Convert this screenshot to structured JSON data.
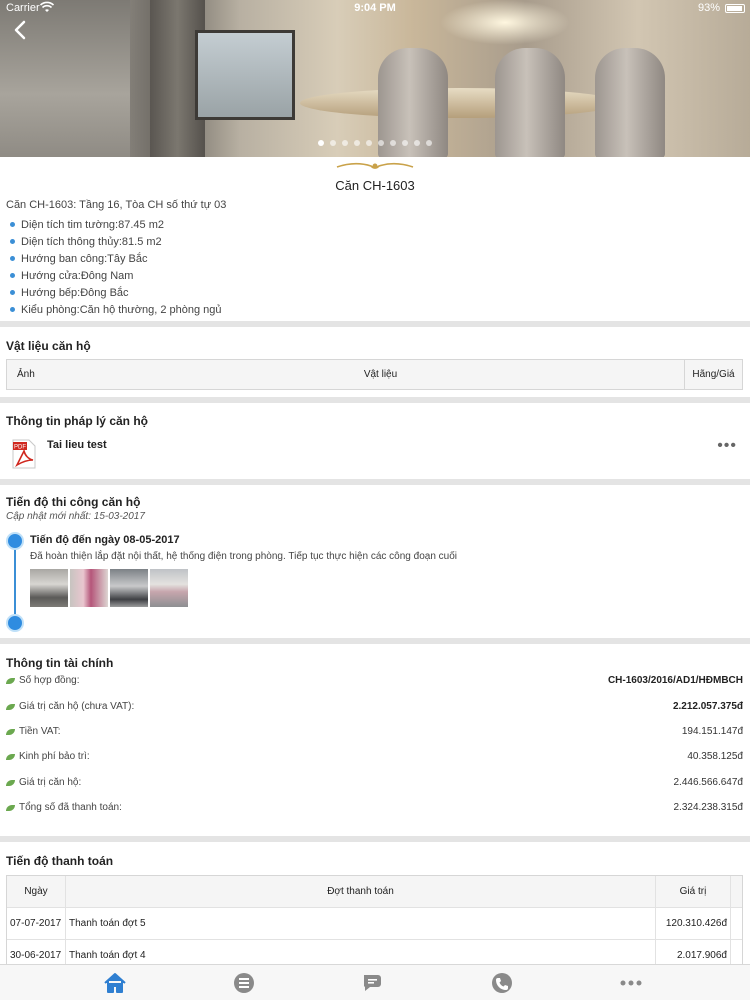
{
  "status_bar": {
    "carrier": "Carrier",
    "time": "9:04 PM",
    "battery": "93%"
  },
  "gallery": {
    "dot_count": 10,
    "active_index": 0
  },
  "apartment": {
    "title": "Căn CH-1603",
    "description": "Căn CH-1603: Tầng 16, Tòa CH số thứ tự 03",
    "specs": [
      "Diện tích tim tường:87.45 m2",
      "Diện tích thông thủy:81.5 m2",
      "Hướng ban công:Tây Bắc",
      "Hướng cửa:Đông Nam",
      "Hướng bếp:Đông Bắc",
      "Kiểu phòng:Căn hộ thường, 2 phòng ngủ"
    ]
  },
  "materials": {
    "title": "Vật liệu căn hộ",
    "columns": [
      "Ảnh",
      "Vật liệu",
      "Hãng/Giá"
    ]
  },
  "legal": {
    "title": "Thông tin pháp lý căn hộ",
    "document": {
      "icon": "pdf-icon",
      "name": "Tai lieu test",
      "more": "•••"
    }
  },
  "construction": {
    "title": "Tiến độ thi công căn hộ",
    "updated": "Cập nhật mới nhất: 15-03-2017",
    "entry": {
      "title": "Tiến độ đến ngày 08-05-2017",
      "description": "Đã hoàn thiện lắp đặt nội thất, hệ thống điện trong phòng. Tiếp tục thực hiện các công đoạn cuối"
    }
  },
  "finance": {
    "title": "Thông tin tài chính",
    "rows": [
      {
        "label": "Số hợp đồng:",
        "value": "CH-1603/2016/AD1/HĐMBCH",
        "bold": true
      },
      {
        "label": "Giá trị căn hộ (chưa VAT):",
        "value": "2.212.057.375đ",
        "bold": true
      },
      {
        "label": "Tiền VAT:",
        "value": "194.151.147đ",
        "bold": false
      },
      {
        "label": "Kinh phí bảo trì:",
        "value": "40.358.125đ",
        "bold": false
      },
      {
        "label": "Giá trị căn hộ:",
        "value": "2.446.566.647đ",
        "bold": false
      },
      {
        "label": "Tổng số đã thanh toán:",
        "value": "2.324.238.315đ",
        "bold": false
      }
    ]
  },
  "payments": {
    "title": "Tiến độ thanh toán",
    "columns": [
      "Ngày",
      "Đợt thanh toán",
      "Giá trị"
    ],
    "rows": [
      {
        "date": "07-07-2017",
        "phase": "Thanh toán đợt 5",
        "amount": "120.310.426đ"
      },
      {
        "date": "30-06-2017",
        "phase": "Thanh toán đợt 4",
        "amount": "2.017.906đ"
      }
    ]
  },
  "tabbar": {
    "accent": "#2f7fd1",
    "inactive": "#8a8a8a",
    "tabs": [
      "home-icon",
      "news-icon",
      "chat-icon",
      "phone-icon",
      "more-icon"
    ]
  }
}
